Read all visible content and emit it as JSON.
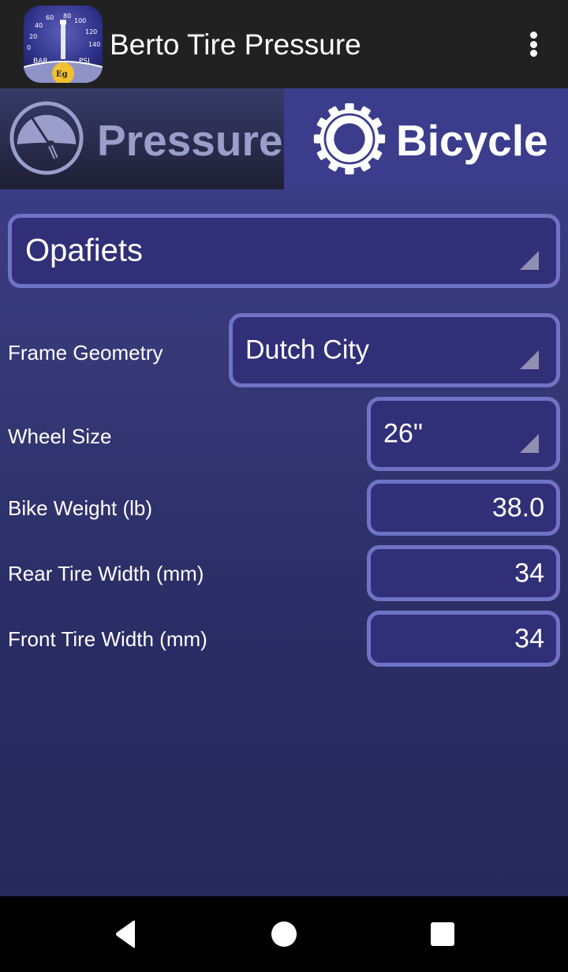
{
  "appbar": {
    "title": "Berto Tire Pressure",
    "icon": "app-logo-gauge",
    "icon_labels": {
      "left": "BAR",
      "right": "PSI",
      "badge": "Eg"
    },
    "overflow_icon": "more-vert-icon"
  },
  "tabs": [
    {
      "label": "Pressure",
      "icon": "gauge-icon",
      "selected": false
    },
    {
      "label": "Bicycle",
      "icon": "gear-icon",
      "selected": true
    }
  ],
  "profile": {
    "value": "Opafiets"
  },
  "fields": {
    "frame_geometry": {
      "label": "Frame Geometry",
      "value": "Dutch City"
    },
    "wheel_size": {
      "label": "Wheel Size",
      "value": "26\""
    },
    "bike_weight": {
      "label": "Bike Weight (lb)",
      "value": "38.0"
    },
    "rear_tire_width": {
      "label": "Rear Tire Width (mm)",
      "value": "34"
    },
    "front_tire_width": {
      "label": "Front Tire Width (mm)",
      "value": "34"
    }
  },
  "navbar": {
    "back": "back-icon",
    "home": "home-icon",
    "recents": "recents-icon"
  },
  "colors": {
    "appbar": "#212121",
    "accent": "#3b3d8c",
    "field_border": "#6f73c6",
    "field_bg": "#322f79",
    "inactive_tab_text": "#9b9dca"
  }
}
